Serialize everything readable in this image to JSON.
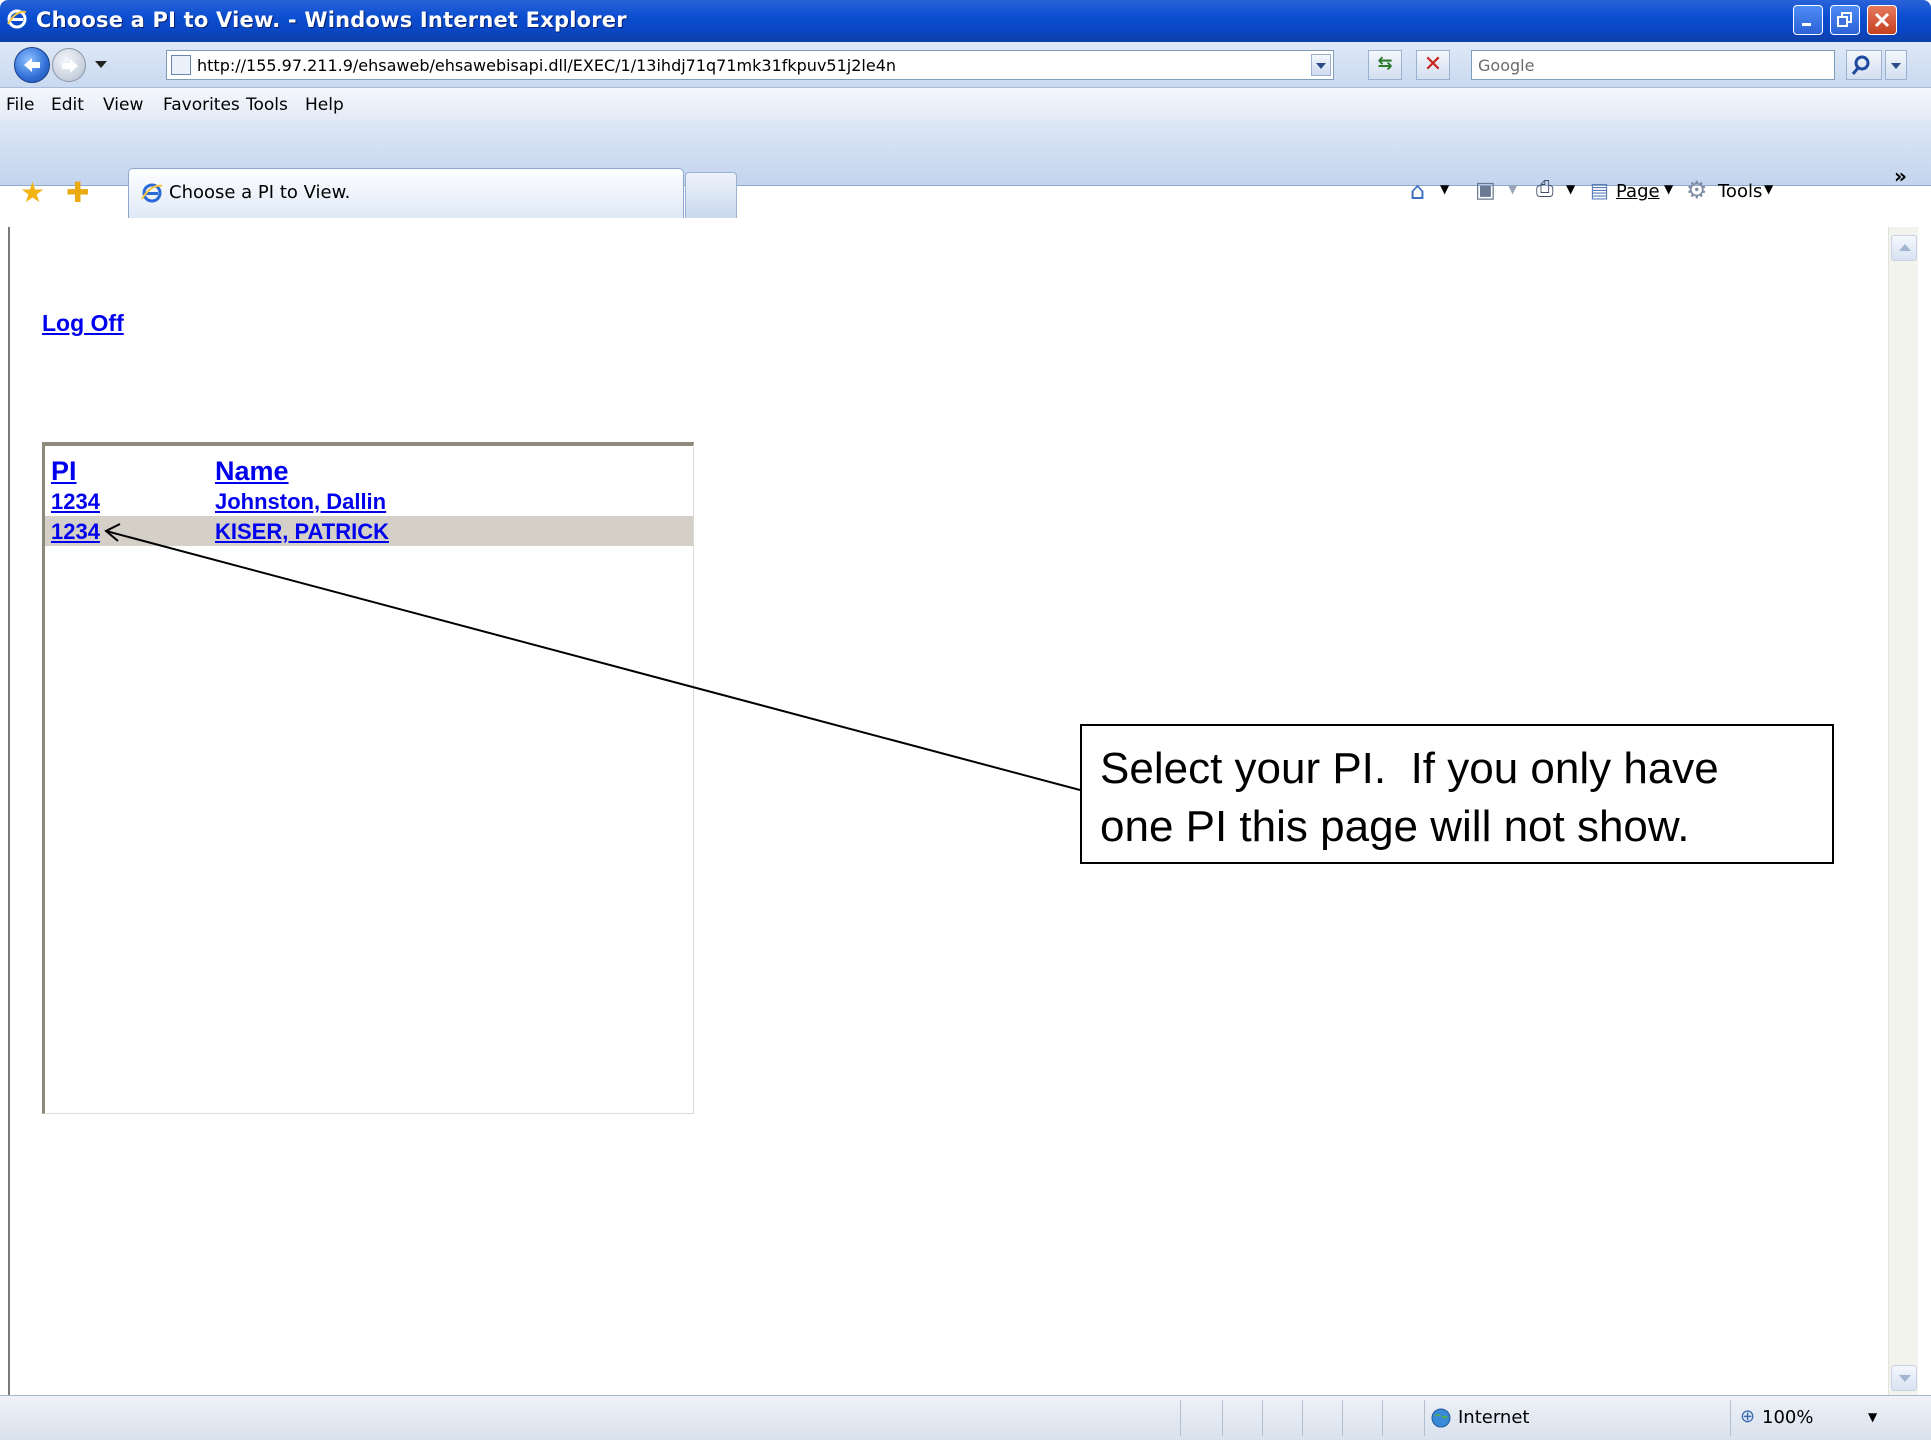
{
  "window": {
    "title": "Choose a PI to View. - Windows Internet Explorer",
    "colors": {
      "titlebar": "#0b4ed1",
      "link": "#0000ee",
      "selected_row": "#d4d0c8"
    }
  },
  "address_bar": {
    "url": "http://155.97.211.9/ehsaweb/ehsawebisapi.dll/EXEC/1/13ihdj71q71mk31fkpuv51j2le4n",
    "search_placeholder": "Google"
  },
  "menu": {
    "items": [
      {
        "label": "File"
      },
      {
        "label": "Edit"
      },
      {
        "label": "View"
      },
      {
        "label": "Favorites"
      },
      {
        "label": "Tools"
      },
      {
        "label": "Help"
      }
    ]
  },
  "tabs": {
    "active_label": "Choose a PI to View."
  },
  "command_bar": {
    "page_label": "Page",
    "tools_label": "Tools",
    "overflow": "»"
  },
  "page": {
    "logoff_label": "Log Off",
    "table": {
      "headers": {
        "pi": "PI",
        "name": "Name"
      },
      "rows": [
        {
          "pi": "1234",
          "name": "Johnston, Dallin",
          "selected": false
        },
        {
          "pi": "1234",
          "name": "KISER, PATRICK",
          "selected": true
        }
      ]
    },
    "callout": {
      "line1": "Select your PI.  If you only have",
      "line2": "one PI this page will not show."
    }
  },
  "status_bar": {
    "zone": "Internet",
    "zoom": "100%"
  }
}
